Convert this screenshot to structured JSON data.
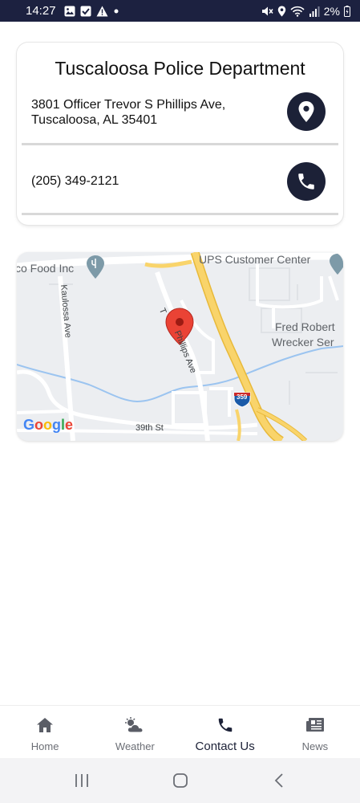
{
  "status_bar": {
    "time": "14:27",
    "battery": "2%",
    "left_icons": [
      "gallery-icon",
      "checkbox-icon",
      "warning-icon",
      "dot-icon"
    ],
    "right_icons": [
      "mute-icon",
      "location-icon",
      "wifi-icon",
      "signal-icon",
      "battery-icon"
    ]
  },
  "card": {
    "title": "Tuscaloosa Police Department",
    "address": "3801 Officer Trevor S Phillips Ave,\nTuscaloosa, AL 35401",
    "phone": "(205) 349-2121"
  },
  "map": {
    "labels": {
      "food": "co Food Inc",
      "ups": "UPS Customer Center",
      "fred1": "Fred Robert",
      "fred2": "Wrecker Ser",
      "kaulossa": "Kaulossa Ave",
      "phillips_prefix": "T",
      "phillips": "Phillips Ave",
      "street39": "39th St",
      "interstate": "359"
    },
    "logo": {
      "letters": [
        "G",
        "o",
        "o",
        "g",
        "l",
        "e"
      ],
      "colors": [
        "#4285F4",
        "#EA4335",
        "#FBBC05",
        "#4285F4",
        "#34A853",
        "#EA4335"
      ]
    },
    "colors": {
      "land": "#eceef1",
      "highway": "#f9d46b",
      "road": "#ffffff",
      "water": "#9bc4f0",
      "pin": "#ea4335"
    }
  },
  "bottom_nav": {
    "items": [
      {
        "label": "Home",
        "icon": "home-icon"
      },
      {
        "label": "Weather",
        "icon": "weather-icon"
      },
      {
        "label": "Contact Us",
        "icon": "phone-icon",
        "active": true
      },
      {
        "label": "News",
        "icon": "news-icon"
      }
    ]
  },
  "system_nav": {
    "buttons": [
      "recent-apps-icon",
      "home-circle-icon",
      "back-icon"
    ]
  }
}
